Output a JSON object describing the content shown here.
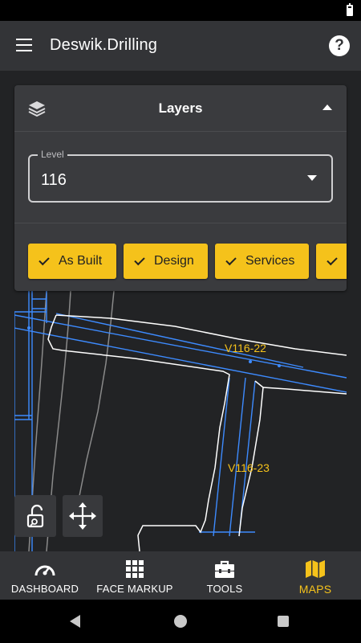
{
  "app": {
    "title": "Deswik.Drilling"
  },
  "layers_panel": {
    "title": "Layers",
    "level_label": "Level",
    "level_value": "116",
    "chips": [
      {
        "label": "As Built",
        "checked": true
      },
      {
        "label": "Design",
        "checked": true
      },
      {
        "label": "Services",
        "checked": true
      },
      {
        "label": "",
        "checked": true
      }
    ]
  },
  "map": {
    "labels": [
      "V116-22",
      "V116-23"
    ],
    "colors": {
      "design": "#3d8bff",
      "as_built": "#ffffff",
      "label": "#f5c21b",
      "services": "#8a8a8a"
    }
  },
  "bottom_nav": {
    "items": [
      {
        "label": "DASHBOARD",
        "icon": "gauge-icon",
        "active": false
      },
      {
        "label": "FACE MARKUP",
        "icon": "grid-icon",
        "active": false
      },
      {
        "label": "TOOLS",
        "icon": "toolbox-icon",
        "active": false
      },
      {
        "label": "MAPS",
        "icon": "map-icon",
        "active": true
      }
    ]
  },
  "colors": {
    "accent": "#f5c21b",
    "app_bar": "#333437",
    "background": "#222325",
    "panel": "#3a3b3e"
  }
}
